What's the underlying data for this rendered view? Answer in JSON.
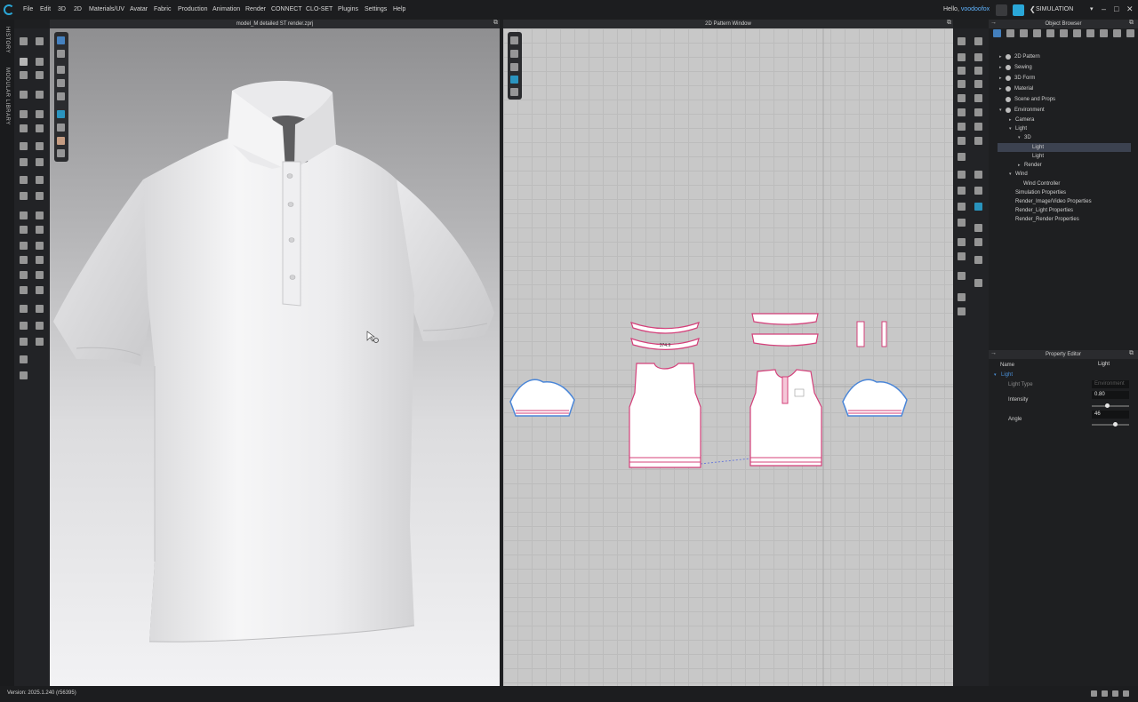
{
  "app": {
    "name": "CLO 3D",
    "accent": "#2aa7d8"
  },
  "menu": [
    "File",
    "Edit",
    "3D",
    "2D",
    "Materials/UV",
    "Avatar",
    "Fabric",
    "Production",
    "Animation",
    "Render",
    "CONNECT",
    "CLO-SET",
    "Plugins",
    "Settings",
    "Help"
  ],
  "header": {
    "greeting": "Hello,",
    "username": "voodoofox",
    "mode": "SIMULATION"
  },
  "sidebar": {
    "history_label": "HISTORY",
    "library_label": "MODULAR LIBRARY"
  },
  "viewport3d": {
    "title": "model_M detailed ST render.zprj"
  },
  "viewport2d": {
    "title": "2D Pattern Window",
    "measure_label": "374.9"
  },
  "object_browser": {
    "title": "Object Browser",
    "tree": [
      {
        "label": "2D Pattern"
      },
      {
        "label": "Sewing"
      },
      {
        "label": "3D Form"
      },
      {
        "label": "Material"
      },
      {
        "label": "Scene and Props"
      },
      {
        "label": "Environment"
      },
      {
        "label": "Camera"
      },
      {
        "label": "Light"
      },
      {
        "label": "3D"
      },
      {
        "label": "Light",
        "selected": true
      },
      {
        "label": "Light"
      },
      {
        "label": "Render"
      },
      {
        "label": "Wind"
      },
      {
        "label": "Wind Controller"
      },
      {
        "label": "Simulation Properties"
      },
      {
        "label": "Render_Image/Video Properties"
      },
      {
        "label": "Render_Light Properties"
      },
      {
        "label": "Render_Render Properties"
      }
    ]
  },
  "property_editor": {
    "title": "Property Editor",
    "name_label": "Name",
    "name_value": "Light",
    "section": "Light",
    "light_type_label": "Light Type",
    "light_type_value": "Environment",
    "intensity_label": "Intensity",
    "intensity_value": "0.80",
    "intensity_level": 0.4,
    "angle_label": "Angle",
    "angle_value": "46",
    "angle_level": 0.62
  },
  "status": {
    "version": "Version: 2025.1.240 (r56395)"
  }
}
